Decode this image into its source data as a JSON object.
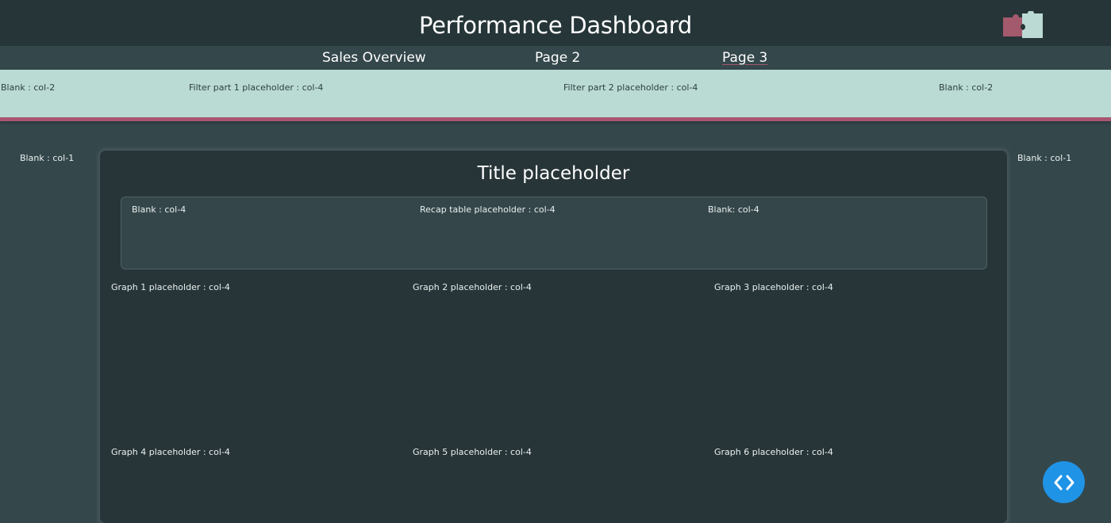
{
  "header": {
    "title": "Performance Dashboard",
    "logo_icon": "puzzle-pieces-icon"
  },
  "nav": {
    "items": [
      {
        "label": "Sales Overview",
        "active": false
      },
      {
        "label": "Page 2",
        "active": false
      },
      {
        "label": "Page 3",
        "active": true
      }
    ]
  },
  "filter_band": {
    "cells": [
      "Blank : col-2",
      "Filter part 1 placeholder : col-4",
      "Filter part 2 placeholder : col-4",
      "Blank : col-2"
    ]
  },
  "side": {
    "left": "Blank : col-1",
    "right": "Blank : col-1"
  },
  "card": {
    "title": "Title placeholder",
    "recap": [
      "Blank : col-4",
      "Recap table placeholder : col-4",
      "Blank: col-4"
    ],
    "graphs_row1": [
      "Graph 1 placeholder : col-4",
      "Graph 2 placeholder : col-4",
      "Graph 3 placeholder : col-4"
    ],
    "graphs_row2": [
      "Graph 4 placeholder : col-4",
      "Graph 5 placeholder : col-4",
      "Graph 6 placeholder : col-4"
    ]
  },
  "fab": {
    "icon": "code-chevrons-icon"
  },
  "colors": {
    "header_bg": "#263538",
    "page_bg": "#34474b",
    "filter_bg": "#badbd4",
    "accent": "#a85672",
    "card_bg": "#273538",
    "fab_bg": "#1f93e6"
  }
}
